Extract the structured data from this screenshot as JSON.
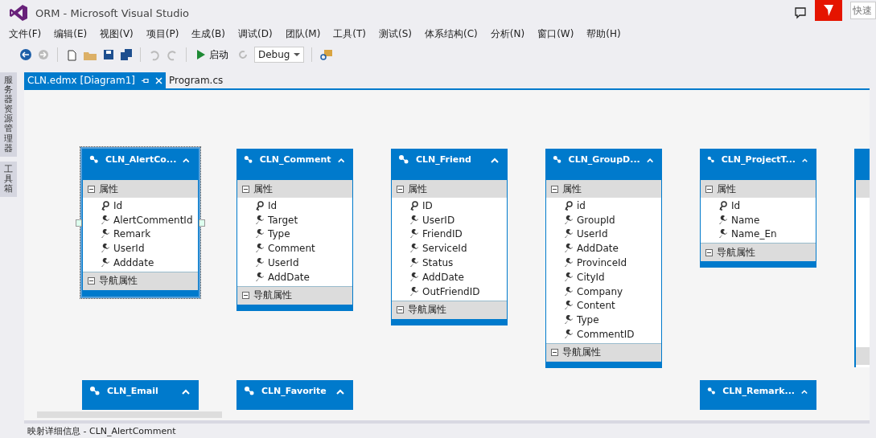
{
  "window": {
    "title": "ORM - Microsoft Visual Studio",
    "quick_launch": {
      "placeholder": "快速"
    }
  },
  "menu": [
    "文件(F)",
    "编辑(E)",
    "视图(V)",
    "项目(P)",
    "生成(B)",
    "调试(D)",
    "团队(M)",
    "工具(T)",
    "测试(S)",
    "体系结构(C)",
    "分析(N)",
    "窗口(W)",
    "帮助(H)"
  ],
  "toolbar": {
    "start_label": "启动",
    "configuration": "Debug"
  },
  "side_tabs": [
    "服务器资源管理器",
    "工具箱"
  ],
  "tabs": [
    {
      "label": "CLN.edmx [Diagram1]",
      "selected": true
    },
    {
      "label": "Program.cs",
      "selected": false
    }
  ],
  "entities": [
    {
      "name": "CLN_AlertCo...",
      "selected": true,
      "expanded": true,
      "section": "属性",
      "nav_section": "导航属性",
      "properties": [
        {
          "name": "Id",
          "kind": "key"
        },
        {
          "name": "AlertCommentId",
          "kind": "scalar"
        },
        {
          "name": "Remark",
          "kind": "scalar"
        },
        {
          "name": "UserId",
          "kind": "scalar"
        },
        {
          "name": "Adddate",
          "kind": "scalar"
        }
      ]
    },
    {
      "name": "CLN_Comment",
      "selected": false,
      "expanded": true,
      "section": "属性",
      "nav_section": "导航属性",
      "properties": [
        {
          "name": "Id",
          "kind": "key"
        },
        {
          "name": "Target",
          "kind": "scalar"
        },
        {
          "name": "Type",
          "kind": "scalar"
        },
        {
          "name": "Comment",
          "kind": "scalar"
        },
        {
          "name": "UserId",
          "kind": "scalar"
        },
        {
          "name": "AddDate",
          "kind": "scalar"
        }
      ]
    },
    {
      "name": "CLN_Friend",
      "selected": false,
      "expanded": true,
      "section": "属性",
      "nav_section": "导航属性",
      "properties": [
        {
          "name": "ID",
          "kind": "key"
        },
        {
          "name": "UserID",
          "kind": "scalar"
        },
        {
          "name": "FriendID",
          "kind": "scalar"
        },
        {
          "name": "ServiceId",
          "kind": "scalar"
        },
        {
          "name": "Status",
          "kind": "scalar"
        },
        {
          "name": "AddDate",
          "kind": "scalar"
        },
        {
          "name": "OutFriendID",
          "kind": "scalar"
        }
      ]
    },
    {
      "name": "CLN_GroupD...",
      "selected": false,
      "expanded": true,
      "section": "属性",
      "nav_section": "导航属性",
      "properties": [
        {
          "name": "id",
          "kind": "key"
        },
        {
          "name": "GroupId",
          "kind": "scalar"
        },
        {
          "name": "UserId",
          "kind": "scalar"
        },
        {
          "name": "AddDate",
          "kind": "scalar"
        },
        {
          "name": "ProvinceId",
          "kind": "scalar"
        },
        {
          "name": "CityId",
          "kind": "scalar"
        },
        {
          "name": "Company",
          "kind": "scalar"
        },
        {
          "name": "Content",
          "kind": "scalar"
        },
        {
          "name": "Type",
          "kind": "scalar"
        },
        {
          "name": "CommentID",
          "kind": "scalar"
        }
      ]
    },
    {
      "name": "CLN_ProjectT...",
      "selected": false,
      "expanded": true,
      "section": "属性",
      "nav_section": "导航属性",
      "properties": [
        {
          "name": "Id",
          "kind": "key"
        },
        {
          "name": "Name",
          "kind": "scalar"
        },
        {
          "name": "Name_En",
          "kind": "scalar"
        }
      ]
    },
    {
      "name": "CLN_Email",
      "selected": false,
      "expanded": false
    },
    {
      "name": "CLN_Favorite",
      "selected": false,
      "expanded": false
    },
    {
      "name": "CLN_Remark...",
      "selected": false,
      "expanded": false
    }
  ],
  "bottom_panel": {
    "title": "映射详细信息 - CLN_AlertComment"
  }
}
